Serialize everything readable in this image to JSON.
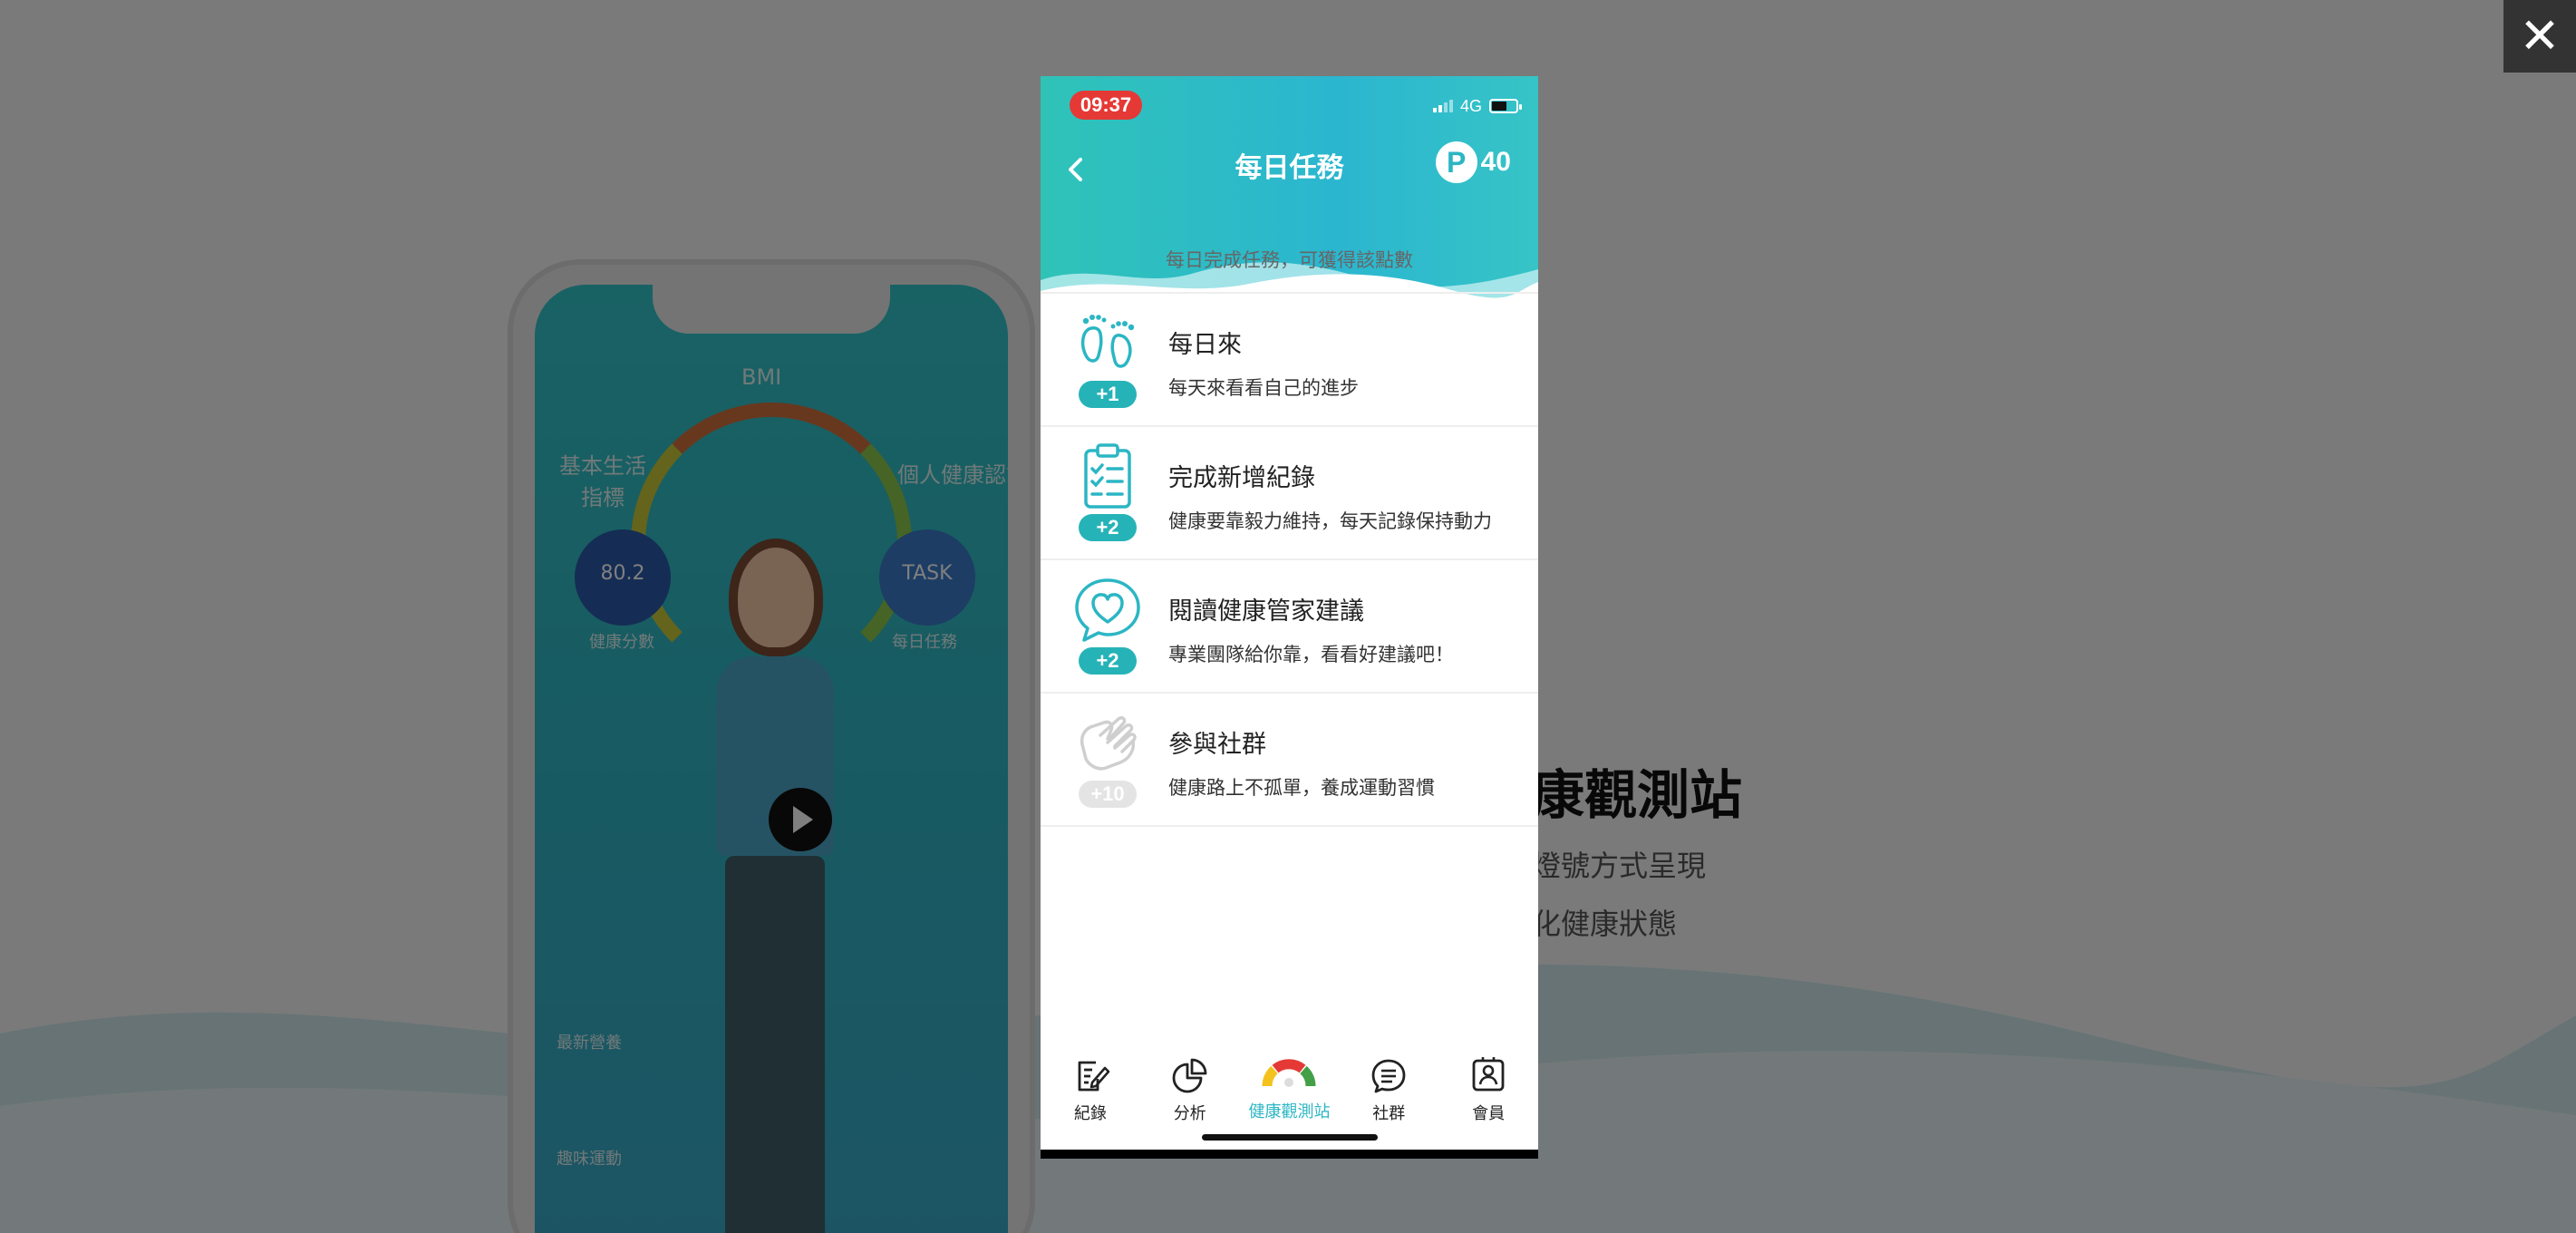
{
  "background": {
    "heading": "康觀測站",
    "lines": [
      "燈號方式呈現",
      "化健康狀態"
    ],
    "phone": {
      "bmi": "BMI",
      "left_label": "基本生活\n指標",
      "right_label": "個人健康認識",
      "score": "80.2",
      "score_caption": "健康分數",
      "task_label": "TASK",
      "task_caption": "每日任務",
      "award_caption": "最新營養",
      "activity_caption": "趣味運動"
    }
  },
  "modal": {
    "close_label": "✕"
  },
  "status_bar": {
    "time": "09:37",
    "network": "4G"
  },
  "header": {
    "title": "每日任務",
    "points_symbol": "P",
    "points_value": "40"
  },
  "subtitle": "每日完成任務，可獲得該點數",
  "tasks": [
    {
      "title": "每日來",
      "desc": "每天來看看自己的進步",
      "badge": "+1",
      "icon": "footprints-icon",
      "completed": false
    },
    {
      "title": "完成新增紀錄",
      "desc": "健康要靠毅力維持，每天記錄保持動力",
      "badge": "+2",
      "icon": "clipboard-checklist-icon",
      "completed": false
    },
    {
      "title": "閱讀健康管家建議",
      "desc": "專業團隊給你靠，看看好建議吧！",
      "badge": "+2",
      "icon": "heart-chat-icon",
      "completed": false
    },
    {
      "title": "參與社群",
      "desc": "健康路上不孤單，養成運動習慣",
      "badge": "+10",
      "icon": "handshake-icon",
      "completed": true
    }
  ],
  "tabbar": [
    {
      "label": "紀錄",
      "icon": "note-edit-icon",
      "active": false
    },
    {
      "label": "分析",
      "icon": "pie-chart-icon",
      "active": false
    },
    {
      "label": "健康觀測站",
      "icon": "gauge-icon",
      "active": true
    },
    {
      "label": "社群",
      "icon": "chat-bubble-icon",
      "active": false
    },
    {
      "label": "會員",
      "icon": "member-card-icon",
      "active": false
    }
  ],
  "colors": {
    "accent": "#2bb6c4",
    "badge_active": "#26b3b8",
    "badge_inactive": "#dddddd",
    "time_pill": "#e53935"
  }
}
